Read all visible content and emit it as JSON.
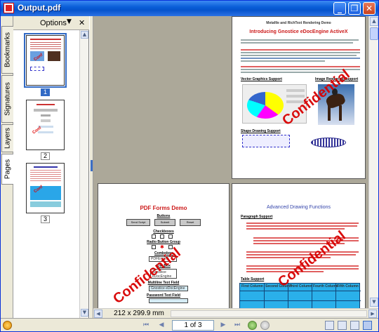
{
  "window": {
    "title": "Output.pdf",
    "minimize": "_",
    "restore": "❐",
    "close": "✕"
  },
  "sidebar": {
    "tabs": [
      "Bookmarks",
      "Signatures",
      "Layers",
      "Pages"
    ],
    "active_tab": "Pages",
    "options_label": "Options",
    "close_label": "✕",
    "thumbnails": [
      {
        "number": "1",
        "selected": true
      },
      {
        "number": "2",
        "selected": false
      },
      {
        "number": "3",
        "selected": false
      }
    ]
  },
  "document": {
    "page1": {
      "header": "Metafile and RichText Rendering Demo",
      "title": "Introducing Gnostice eDocEngine ActiveX",
      "section_vector": "Vector Graphics Support",
      "section_image": "Image Rendering Support",
      "section_shape": "Shape Drawing Support",
      "watermark": "Confidential"
    },
    "page2": {
      "title": "PDF Forms Demo",
      "buttons_label": "Buttons",
      "button_labels": [
        "Send Script",
        "Submit",
        "Reset"
      ],
      "checkboxes_label": "Checkboxes",
      "radio_label": "Radio Button Group",
      "combobox_label": "Combobox",
      "combobox_value": "PDFEngine",
      "listbox_label": "List Box",
      "listbox_items": [
        "Gnostice",
        "eDocEngine"
      ],
      "text_label": "Multiline Text Field",
      "text_field": "Gnostice eDocEngine",
      "password_label": "Password Text Field",
      "watermark": "Confidential"
    },
    "page3": {
      "title": "Advanced Drawing Functions",
      "section_paragraph": "Paragraph Support",
      "section_table": "Table Support",
      "table_headers": [
        "First Column",
        "Second Column",
        "Third Column",
        "Fourth Column",
        "Fifth Column"
      ],
      "watermark": "Confidential"
    }
  },
  "page_size": "212 x 299.9 mm",
  "statusbar": {
    "page_info": "1 of 3",
    "first": "⏮",
    "prev": "◀",
    "next": "▶",
    "last": "⏭"
  }
}
